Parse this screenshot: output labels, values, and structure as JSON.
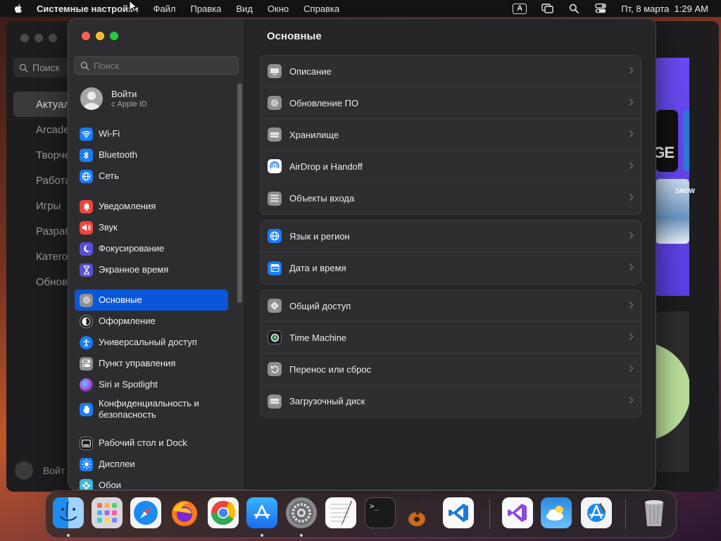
{
  "menubar": {
    "app_name": "Системные настройки",
    "menus": [
      "Файл",
      "Правка",
      "Вид",
      "Окно",
      "Справка"
    ],
    "input_source": "A",
    "datetime": "Пт, 8 марта  1:29 AM"
  },
  "background_window": {
    "search_placeholder": "Поиск",
    "sidebar_items": [
      "Актуал",
      "Arcade",
      "Творче",
      "Работа",
      "Игры",
      "Разраб",
      "Катего",
      "Обнов"
    ],
    "account_label": "Войт",
    "tile_text": "GE",
    "tile_text_2": "SNOW"
  },
  "settings": {
    "search_placeholder": "Поиск",
    "account": {
      "title": "Войти",
      "subtitle": "с Apple ID"
    },
    "sidebar": [
      {
        "label": "Wi-Fi",
        "icon": "wifi-icon",
        "color": "#1a7cf5"
      },
      {
        "label": "Bluetooth",
        "icon": "bluetooth-icon",
        "color": "#1a7cf5"
      },
      {
        "label": "Сеть",
        "icon": "globe-icon",
        "color": "#1a7cf5"
      },
      {
        "label": "Уведомления",
        "icon": "bell-icon",
        "color": "#f0453a"
      },
      {
        "label": "Звук",
        "icon": "speaker-icon",
        "color": "#f0453a"
      },
      {
        "label": "Фокусирование",
        "icon": "moon-icon",
        "color": "#5a4fd6"
      },
      {
        "label": "Экранное время",
        "icon": "hourglass-icon",
        "color": "#5a4fd6"
      },
      {
        "label": "Основные",
        "icon": "gear-icon",
        "color": "#8e8e93"
      },
      {
        "label": "Оформление",
        "icon": "appearance-icon",
        "color": "#1c1c1e"
      },
      {
        "label": "Универсальный доступ",
        "icon": "accessibility-icon",
        "color": "#1a7cf5"
      },
      {
        "label": "Пункт управления",
        "icon": "control-center-icon",
        "color": "#8e8e93"
      },
      {
        "label": "Siri и Spotlight",
        "icon": "siri-icon",
        "color": "#c23ad6"
      },
      {
        "label": "Конфиденциальность и безопасность",
        "icon": "hand-icon",
        "color": "#1a7cf5"
      },
      {
        "label": "Рабочий стол и Dock",
        "icon": "desktop-icon",
        "color": "#1c1c1e"
      },
      {
        "label": "Дисплеи",
        "icon": "sun-icon",
        "color": "#1a7cf5"
      },
      {
        "label": "Обои",
        "icon": "wallpaper-icon",
        "color": "#40b6d8"
      }
    ],
    "main": {
      "title": "Основные",
      "groups": [
        [
          {
            "label": "Описание",
            "icon": "display-icon",
            "color": "#8e8e93"
          },
          {
            "label": "Обновление ПО",
            "icon": "gear-icon",
            "color": "#8e8e93"
          },
          {
            "label": "Хранилище",
            "icon": "drive-icon",
            "color": "#8e8e93"
          },
          {
            "label": "AirDrop и Handoff",
            "icon": "airdrop-icon",
            "color": "#ffffff"
          },
          {
            "label": "Объекты входа",
            "icon": "list-icon",
            "color": "#8e8e93"
          }
        ],
        [
          {
            "label": "Язык и регион",
            "icon": "globe-icon",
            "color": "#1a7cf5"
          },
          {
            "label": "Дата и время",
            "icon": "calendar-icon",
            "color": "#1a7cf5"
          }
        ],
        [
          {
            "label": "Общий доступ",
            "icon": "sharing-icon",
            "color": "#8e8e93"
          },
          {
            "label": "Time Machine",
            "icon": "time-machine-icon",
            "color": "#1c1c1e"
          },
          {
            "label": "Перенос или сброс",
            "icon": "reset-icon",
            "color": "#8e8e93"
          },
          {
            "label": "Загрузочный диск",
            "icon": "drive-icon",
            "color": "#8e8e93"
          }
        ]
      ]
    }
  },
  "dock": {
    "apps": [
      {
        "name": "finder-icon",
        "running": true
      },
      {
        "name": "launchpad-icon",
        "running": false
      },
      {
        "name": "safari-icon",
        "running": false
      },
      {
        "name": "firefox-icon",
        "running": false
      },
      {
        "name": "chrome-icon",
        "running": false
      },
      {
        "name": "app-store-icon",
        "running": true
      },
      {
        "name": "system-settings-icon",
        "running": true
      },
      {
        "name": "textedit-icon",
        "running": false
      },
      {
        "name": "terminal-icon",
        "running": false
      },
      {
        "name": "garageband-icon",
        "running": false
      },
      {
        "name": "vscode-icon",
        "running": false
      },
      {
        "name": "visual-studio-icon",
        "running": false
      },
      {
        "name": "weather-icon",
        "running": false
      },
      {
        "name": "xcode-icon",
        "running": false
      },
      {
        "name": "trash-icon",
        "running": false
      }
    ],
    "terminal_prompt": ">_"
  }
}
